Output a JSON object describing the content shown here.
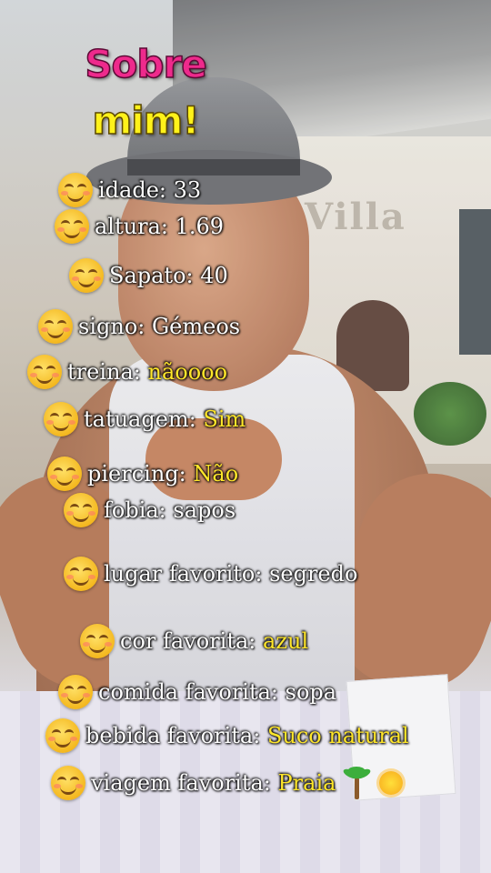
{
  "title": {
    "line1": "Sobre",
    "line2": "mim!"
  },
  "background": {
    "sign_text": "Villa"
  },
  "items": [
    {
      "label": "idade:",
      "value": "33",
      "value_color": "white"
    },
    {
      "label": "altura:",
      "value": "1.69",
      "value_color": "white"
    },
    {
      "label": "Sapato:",
      "value": "40",
      "value_color": "white"
    },
    {
      "label": "signo:",
      "value": "Gémeos",
      "value_color": "white"
    },
    {
      "label": "treina:",
      "value": "nãoooo",
      "value_color": "yellow"
    },
    {
      "label": "tatuagem:",
      "value": "Sim",
      "value_color": "yellow"
    },
    {
      "label": "piercing:",
      "value": "Não",
      "value_color": "yellow"
    },
    {
      "label": "fobia:",
      "value": "sapos",
      "value_color": "white"
    },
    {
      "label": "lugar favorito:",
      "value": "segredo",
      "value_color": "white"
    },
    {
      "label": "cor favorita:",
      "value": "azul",
      "value_color": "yellow"
    },
    {
      "label": "comida favorita:",
      "value": "sopa",
      "value_color": "white"
    },
    {
      "label": "bebida favorita:",
      "value": "Suco natural",
      "value_color": "yellow"
    },
    {
      "label": "viagem  favorita:",
      "value": "Praia",
      "value_color": "yellow",
      "icons": [
        "palm-tree-icon",
        "sun-icon"
      ]
    }
  ],
  "icons": {
    "bullet": "smiling-face-icon"
  },
  "colors": {
    "title_pink": "#ee2a8c",
    "title_yellow": "#fff21a",
    "highlight_yellow": "#ffe62a"
  }
}
